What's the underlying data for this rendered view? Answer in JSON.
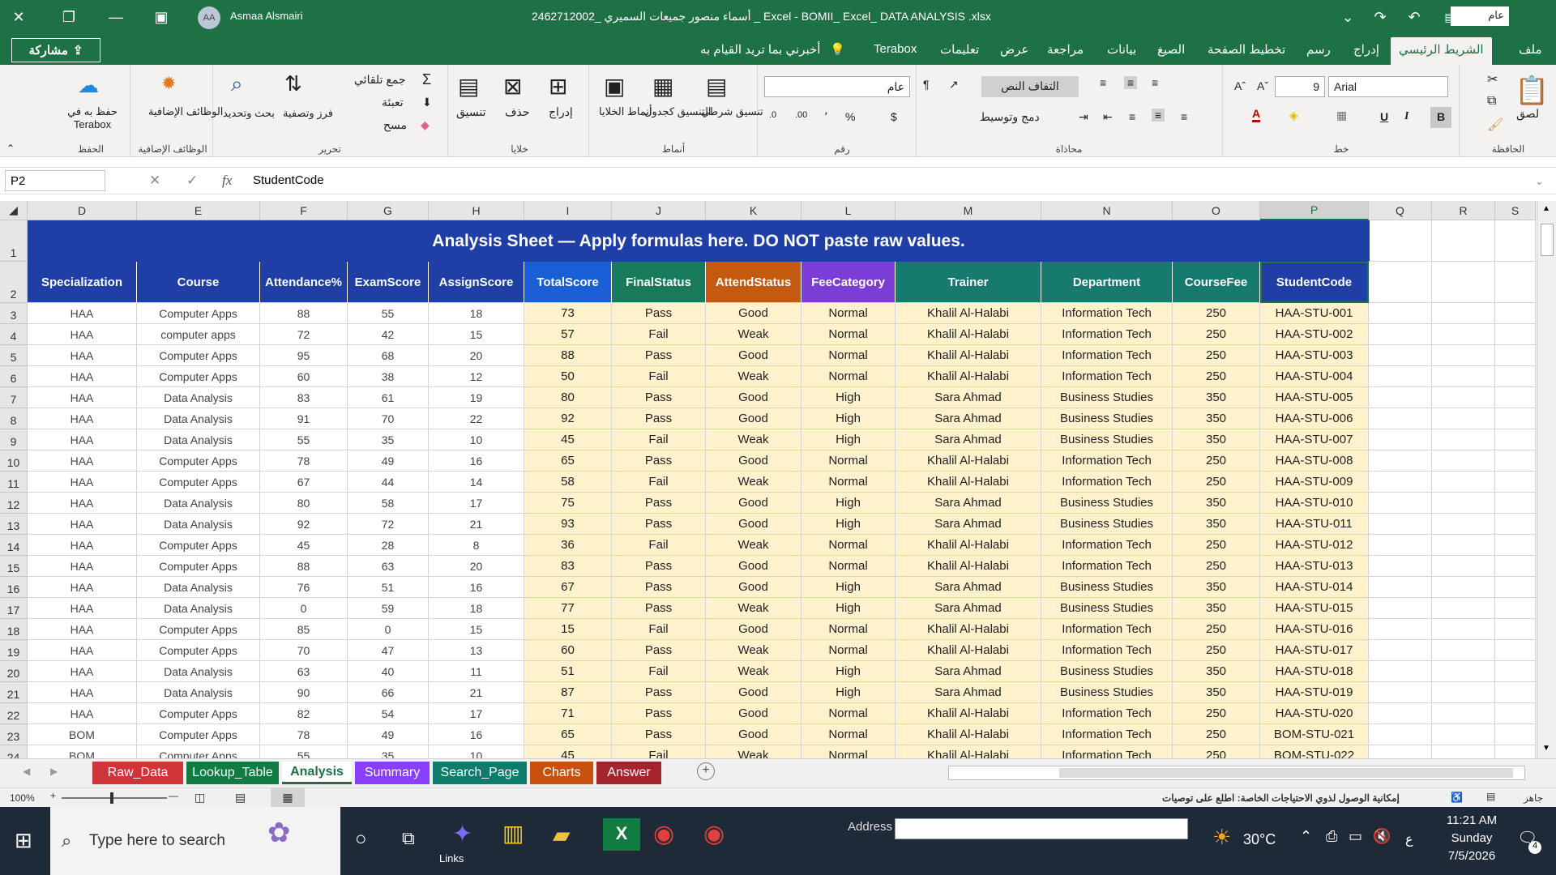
{
  "title_bar": {
    "title": "2462712002_ أسماء منصور جميعات السميري _ Excel  -  BOMII_ Excel_ DATA ANALYSIS .xlsx",
    "user": "Asmaa Alsmairi",
    "avatar": "AA",
    "font_box": "عام"
  },
  "share_label": "مشاركة",
  "tabs": [
    "ملف",
    "الشريط الرئيسي",
    "إدراج",
    "رسم",
    "تخطيط الصفحة",
    "الصيغ",
    "بيانات",
    "مراجعة",
    "عرض",
    "تعليمات",
    "Terabox",
    "أخبرني بما تريد القيام به"
  ],
  "ribbon": {
    "clipboard": {
      "label": "الحافظة",
      "paste": "لصق"
    },
    "font": {
      "label": "خط",
      "name": "Arial",
      "size": "9",
      "bold": "B",
      "italic": "I",
      "underline": "U"
    },
    "alignment": {
      "label": "محاذاة",
      "wrap": "التفاف النص",
      "merge": "دمج وتوسيط"
    },
    "number": {
      "label": "رقم",
      "format": "عام",
      "currency": "$",
      "percent": "%",
      "comma": "٬"
    },
    "styles": {
      "label": "أنماط",
      "conditional": "تنسيق شرطي",
      "as_table": "التنسيق كجدول",
      "cell_styles": "أنماط الخلايا"
    },
    "cells": {
      "label": "خلايا",
      "insert": "إدراج",
      "delete": "حذف",
      "format": "تنسيق"
    },
    "editing": {
      "label": "تحرير",
      "autosum": "جمع تلقائي",
      "fill": "تعبئة",
      "clear": "مسح",
      "sort": "فرز وتصفية",
      "find": "بحث وتحديد"
    },
    "addins": {
      "label": "الوظائف الإضافية",
      "button": "الوظائف الإضافية"
    },
    "save": {
      "label": "الحفظ",
      "button": "حفظ به في Terabox"
    }
  },
  "formula_bar": {
    "name_box": "P2",
    "formula": "StudentCode",
    "fx": "fx"
  },
  "grid": {
    "columns": [
      "D",
      "E",
      "F",
      "G",
      "H",
      "I",
      "J",
      "K",
      "L",
      "M",
      "N",
      "O",
      "P",
      "Q",
      "R",
      "S"
    ],
    "banner": "Analysis Sheet — Apply formulas here. DO NOT paste raw values.",
    "headers": [
      "Specialization",
      "Course",
      "Attendance%",
      "ExamScore",
      "AssignScore",
      "TotalScore",
      "FinalStatus",
      "AttendStatus",
      "FeeCategory",
      "Trainer",
      "Department",
      "CourseFee",
      "StudentCode"
    ],
    "header_colors": [
      "#1f3fa6",
      "#1f3fa6",
      "#1f3fa6",
      "#1f3fa6",
      "#1f3fa6",
      "#1b5fd6",
      "#177a5a",
      "#c45a10",
      "#7a3ed6",
      "#177a6e",
      "#177a6e",
      "#177a6e",
      "#1f3fa6"
    ],
    "rows": [
      [
        "HAA",
        "Computer Apps",
        "88",
        "55",
        "18",
        "73",
        "Pass",
        "Good",
        "Normal",
        "Khalil Al-Halabi",
        "Information Tech",
        "250",
        "HAA-STU-001"
      ],
      [
        "HAA",
        "computer apps",
        "72",
        "42",
        "15",
        "57",
        "Fail",
        "Weak",
        "Normal",
        "Khalil Al-Halabi",
        "Information Tech",
        "250",
        "HAA-STU-002"
      ],
      [
        "HAA",
        "Computer Apps",
        "95",
        "68",
        "20",
        "88",
        "Pass",
        "Good",
        "Normal",
        "Khalil Al-Halabi",
        "Information Tech",
        "250",
        "HAA-STU-003"
      ],
      [
        "HAA",
        "Computer Apps",
        "60",
        "38",
        "12",
        "50",
        "Fail",
        "Weak",
        "Normal",
        "Khalil Al-Halabi",
        "Information Tech",
        "250",
        "HAA-STU-004"
      ],
      [
        "HAA",
        "Data Analysis",
        "83",
        "61",
        "19",
        "80",
        "Pass",
        "Good",
        "High",
        "Sara Ahmad",
        "Business Studies",
        "350",
        "HAA-STU-005"
      ],
      [
        "HAA",
        "Data Analysis",
        "91",
        "70",
        "22",
        "92",
        "Pass",
        "Good",
        "High",
        "Sara Ahmad",
        "Business Studies",
        "350",
        "HAA-STU-006"
      ],
      [
        "HAA",
        "Data Analysis",
        "55",
        "35",
        "10",
        "45",
        "Fail",
        "Weak",
        "High",
        "Sara Ahmad",
        "Business Studies",
        "350",
        "HAA-STU-007"
      ],
      [
        "HAA",
        "Computer Apps",
        "78",
        "49",
        "16",
        "65",
        "Pass",
        "Good",
        "Normal",
        "Khalil Al-Halabi",
        "Information Tech",
        "250",
        "HAA-STU-008"
      ],
      [
        "HAA",
        "Computer Apps",
        "67",
        "44",
        "14",
        "58",
        "Fail",
        "Weak",
        "Normal",
        "Khalil Al-Halabi",
        "Information Tech",
        "250",
        "HAA-STU-009"
      ],
      [
        "HAA",
        "Data Analysis",
        "80",
        "58",
        "17",
        "75",
        "Pass",
        "Good",
        "High",
        "Sara Ahmad",
        "Business Studies",
        "350",
        "HAA-STU-010"
      ],
      [
        "HAA",
        "Data Analysis",
        "92",
        "72",
        "21",
        "93",
        "Pass",
        "Good",
        "High",
        "Sara Ahmad",
        "Business Studies",
        "350",
        "HAA-STU-011"
      ],
      [
        "HAA",
        "Computer Apps",
        "45",
        "28",
        "8",
        "36",
        "Fail",
        "Weak",
        "Normal",
        "Khalil Al-Halabi",
        "Information Tech",
        "250",
        "HAA-STU-012"
      ],
      [
        "HAA",
        "Computer Apps",
        "88",
        "63",
        "20",
        "83",
        "Pass",
        "Good",
        "Normal",
        "Khalil Al-Halabi",
        "Information Tech",
        "250",
        "HAA-STU-013"
      ],
      [
        "HAA",
        "Data Analysis",
        "76",
        "51",
        "16",
        "67",
        "Pass",
        "Good",
        "High",
        "Sara Ahmad",
        "Business Studies",
        "350",
        "HAA-STU-014"
      ],
      [
        "HAA",
        "Data Analysis",
        "0",
        "59",
        "18",
        "77",
        "Pass",
        "Weak",
        "High",
        "Sara Ahmad",
        "Business Studies",
        "350",
        "HAA-STU-015"
      ],
      [
        "HAA",
        "Computer Apps",
        "85",
        "0",
        "15",
        "15",
        "Fail",
        "Good",
        "Normal",
        "Khalil Al-Halabi",
        "Information Tech",
        "250",
        "HAA-STU-016"
      ],
      [
        "HAA",
        "Computer Apps",
        "70",
        "47",
        "13",
        "60",
        "Pass",
        "Weak",
        "Normal",
        "Khalil Al-Halabi",
        "Information Tech",
        "250",
        "HAA-STU-017"
      ],
      [
        "HAA",
        "Data Analysis",
        "63",
        "40",
        "11",
        "51",
        "Fail",
        "Weak",
        "High",
        "Sara Ahmad",
        "Business Studies",
        "350",
        "HAA-STU-018"
      ],
      [
        "HAA",
        "Data Analysis",
        "90",
        "66",
        "21",
        "87",
        "Pass",
        "Good",
        "High",
        "Sara Ahmad",
        "Business Studies",
        "350",
        "HAA-STU-019"
      ],
      [
        "HAA",
        "Computer Apps",
        "82",
        "54",
        "17",
        "71",
        "Pass",
        "Good",
        "Normal",
        "Khalil Al-Halabi",
        "Information Tech",
        "250",
        "HAA-STU-020"
      ],
      [
        "BOM",
        "Computer Apps",
        "78",
        "49",
        "16",
        "65",
        "Pass",
        "Good",
        "Normal",
        "Khalil Al-Halabi",
        "Information Tech",
        "250",
        "BOM-STU-021"
      ],
      [
        "BOM",
        "Computer Apps",
        "55",
        "35",
        "10",
        "45",
        "Fail",
        "Weak",
        "Normal",
        "Khalil Al-Halabi",
        "Information Tech",
        "250",
        "BOM-STU-022"
      ]
    ]
  },
  "sheet_tabs": [
    {
      "name": "Raw_Data",
      "color": "#d13438"
    },
    {
      "name": "Lookup_Table",
      "color": "#107c41"
    },
    {
      "name": "Analysis",
      "color": "#ffffff"
    },
    {
      "name": "Summary",
      "color": "#8a3ffc"
    },
    {
      "name": "Search_Page",
      "color": "#0f7b6c"
    },
    {
      "name": "Charts",
      "color": "#ca5010"
    },
    {
      "name": "Answer",
      "color": "#a4262c"
    }
  ],
  "status": {
    "ready": "جاهز",
    "accessibility": "إمكانية الوصول لذوي الاحتياجات الخاصة: اطلع على توصيات",
    "zoom": "100%"
  },
  "taskbar": {
    "search": "Type here to search",
    "links": "Links",
    "address": "Address",
    "temp": "30°C",
    "time": "11:21 AM",
    "day": "Sunday",
    "date": "7/5/2026",
    "lang": "ع",
    "notif": "4"
  }
}
